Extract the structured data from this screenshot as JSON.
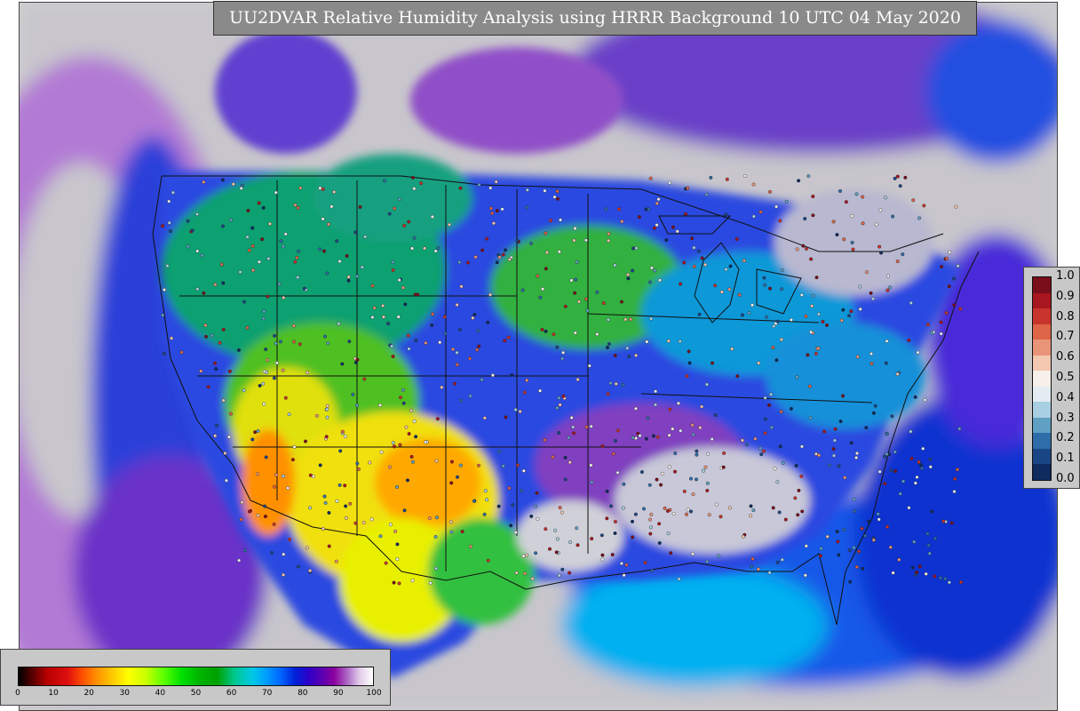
{
  "title": "UU2DVAR Relative Humidity Analysis using HRRR Background 10 UTC 04 May 2020",
  "rh_colorbar": {
    "ticks": [
      "1.0",
      "0.9",
      "0.8",
      "0.7",
      "0.6",
      "0.5",
      "0.4",
      "0.3",
      "0.2",
      "0.1",
      "0.0"
    ],
    "colors": [
      "#7a0e1a",
      "#a8161f",
      "#c9342c",
      "#de6447",
      "#e99478",
      "#f4c7b0",
      "#f6efea",
      "#e3ecf2",
      "#a9cfe2",
      "#5fa0c3",
      "#2e6da8",
      "#1b4685",
      "#0e2a5e"
    ]
  },
  "wv_colorbar": {
    "ticks": [
      "0",
      "10",
      "20",
      "30",
      "40",
      "50",
      "60",
      "70",
      "80",
      "90",
      "100"
    ]
  },
  "map": {
    "ocean_colors": [
      "#cfcfcf",
      "#b070d0",
      "#2040d8",
      "#0090f0"
    ],
    "land_colors": [
      "#00a060",
      "#30c040",
      "#f0f000",
      "#ffb000",
      "#3050e0",
      "#8040c0",
      "#d8d8e0"
    ]
  }
}
